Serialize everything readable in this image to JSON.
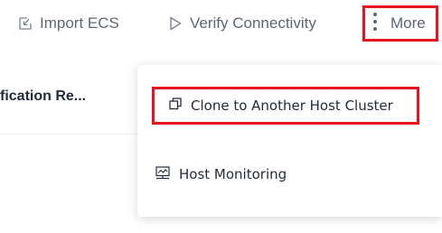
{
  "toolbar": {
    "import_label": "Import ECS",
    "import_icon": "import-icon",
    "verify_label": "Verify Connectivity",
    "verify_icon": "play-outline-icon",
    "more_label": "More",
    "more_icon": "vertical-dots-icon"
  },
  "table": {
    "column_header": "fication Re..."
  },
  "more_menu": {
    "items": [
      {
        "label": "Clone to Another Host Cluster",
        "icon": "clone-icon"
      },
      {
        "label": "Host Monitoring",
        "icon": "monitor-icon"
      }
    ]
  },
  "colors": {
    "highlight": "#e8131f",
    "toolbar_text": "#5e6675",
    "text": "#252b3a"
  }
}
